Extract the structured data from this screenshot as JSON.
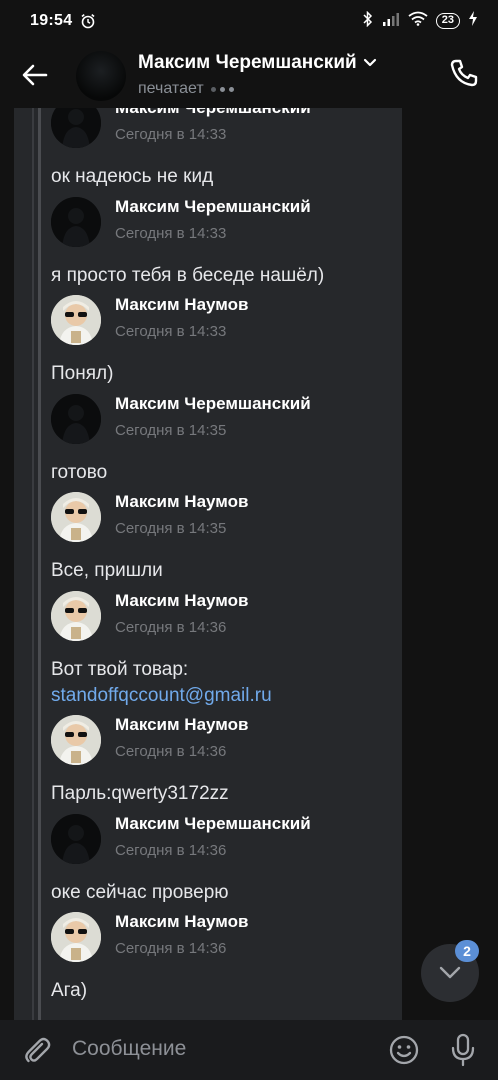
{
  "statusbar": {
    "time": "19:54",
    "battery": "23",
    "battery_level_percent": 23
  },
  "header": {
    "title": "Максим Черемшанский",
    "subtitle": "печатает"
  },
  "messages": [
    {
      "author": "Максим Черемшанский",
      "time": "Сегодня в 14:33",
      "text": "ок надеюсь не кид",
      "avatar": "dark"
    },
    {
      "author": "Максим Черемшанский",
      "time": "Сегодня в 14:33",
      "text": "я просто тебя в беседе нашёл)",
      "avatar": "dark"
    },
    {
      "author": "Максим Наумов",
      "time": "Сегодня в 14:33",
      "text": "Понял)",
      "avatar": "light"
    },
    {
      "author": "Максим Черемшанский",
      "time": "Сегодня в 14:35",
      "text": "готово",
      "avatar": "dark"
    },
    {
      "author": "Максим Наумов",
      "time": "Сегодня в 14:35",
      "text": "Все, пришли",
      "avatar": "light"
    },
    {
      "author": "Максим Наумов",
      "time": "Сегодня в 14:36",
      "text": "Вот твой товар:",
      "link": "standoffqccount@gmail.ru",
      "avatar": "light"
    },
    {
      "author": "Максим Наумов",
      "time": "Сегодня в 14:36",
      "text": "Парль:qwerty3172zz",
      "avatar": "light"
    },
    {
      "author": "Максим Черемшанский",
      "time": "Сегодня в 14:36",
      "text": "оке сейчас проверю",
      "avatar": "dark"
    },
    {
      "author": "Максим Наумов",
      "time": "Сегодня в 14:36",
      "text": "Ага)",
      "avatar": "light"
    }
  ],
  "scroll_down": {
    "unread_count": "2"
  },
  "composer": {
    "placeholder": "Сообщение"
  },
  "colors": {
    "link": "#71aaeb",
    "badge": "#5b8fd6",
    "panel": "#26282b"
  }
}
